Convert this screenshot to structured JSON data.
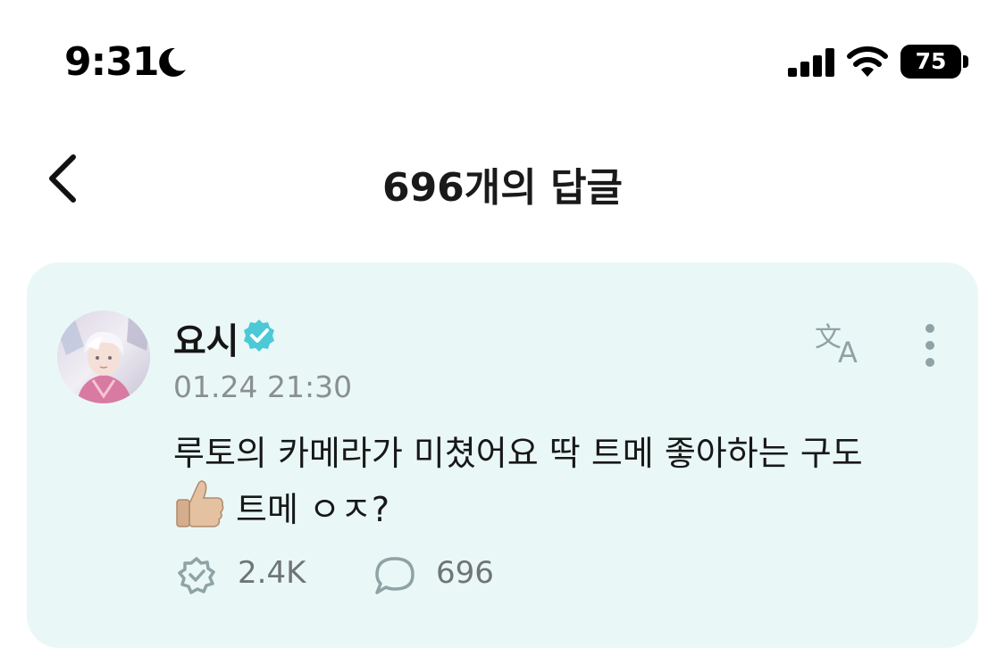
{
  "status_bar": {
    "time": "9:31",
    "focus_icon": "moon-icon",
    "signal_icon": "cellular-signal-icon",
    "wifi_icon": "wifi-icon",
    "battery_level": "75"
  },
  "header": {
    "back_icon": "chevron-left-icon",
    "title": "696개의 답글"
  },
  "post": {
    "author": "요시",
    "verified_icon": "verified-badge-icon",
    "timestamp": "01.24 21:30",
    "translate_icon": "translate-icon",
    "more_icon": "more-vertical-icon",
    "content_line1": "루토의 카메라가 미쳤어요 딱 트메 좋아하는 구도",
    "content_line2_emoji": "thumbs-up-icon",
    "content_line2_text": "트메 ㅇㅈ?",
    "likes_icon": "heart-badge-icon",
    "likes_count": "2.4K",
    "comments_icon": "comment-bubble-icon",
    "comments_count": "696"
  },
  "colors": {
    "card_background": "#e9f8f6",
    "verified": "#4cc9d6",
    "muted_text": "#8a8f92"
  }
}
